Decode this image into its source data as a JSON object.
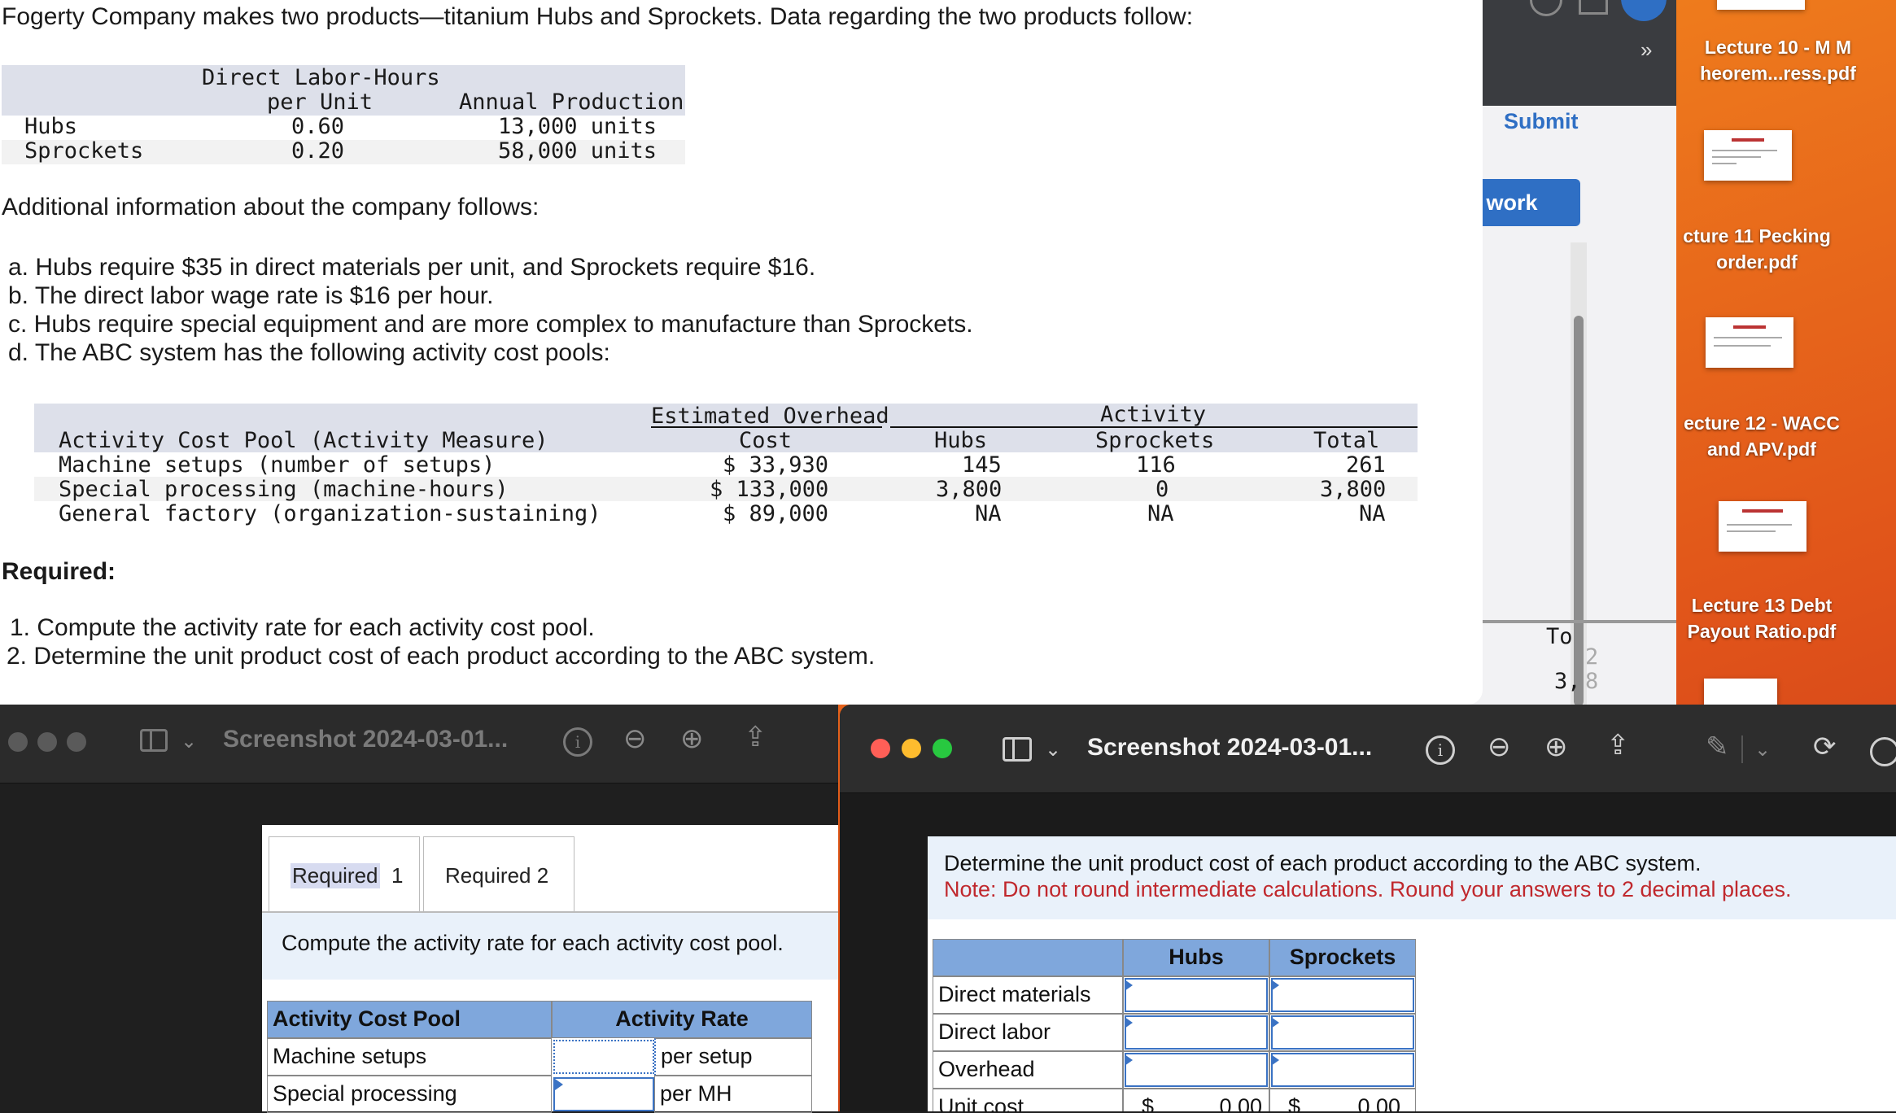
{
  "problem": {
    "intro": "Fogerty Company makes two products—titanium Hubs and Sprockets. Data regarding the two products follow:",
    "product_table": {
      "header_dlh_line1": "Direct Labor-Hours",
      "header_dlh_line2": "per Unit",
      "header_annual": "Annual Production",
      "rows": [
        {
          "name": "Hubs",
          "dlh": "0.60",
          "production": "13,000 units"
        },
        {
          "name": "Sprockets",
          "dlh": "0.20",
          "production": "58,000 units"
        }
      ]
    },
    "additional_heading": "Additional information about the company follows:",
    "items": [
      "a. Hubs require $35 in direct materials per unit, and Sprockets require $16.",
      "b. The direct labor wage rate is $16 per hour.",
      "c. Hubs require special equipment and are more complex to manufacture than Sprockets.",
      "d. The ABC system has the following activity cost pools:"
    ],
    "activity_table": {
      "header_pool": "Activity Cost Pool (Activity Measure)",
      "header_est_line1": "Estimated Overhead",
      "header_est_line2": "Cost",
      "header_activity": "Activity",
      "header_hubs": "Hubs",
      "header_sprockets": "Sprockets",
      "header_total": "Total",
      "rows": [
        {
          "pool": "Machine setups (number of setups)",
          "cost": "$ 33,930",
          "hubs": "145",
          "sprockets": "116",
          "total": "261"
        },
        {
          "pool": "Special processing (machine-hours)",
          "cost": "$ 133,000",
          "hubs": "3,800",
          "sprockets": "0",
          "total": "3,800"
        },
        {
          "pool": "General factory (organization-sustaining)",
          "cost": "$ 89,000",
          "hubs": "NA",
          "sprockets": "NA",
          "total": "NA"
        }
      ]
    },
    "required_heading": "Required:",
    "requirements": [
      "1. Compute the activity rate for each activity cost pool.",
      "2. Determine the unit product cost of each product according to the ABC system."
    ]
  },
  "browser": {
    "overflow_chevron": "»",
    "submit": "Submit",
    "my_work_partial": "y work",
    "partial_total_header": "To",
    "partial_total_a": "2",
    "partial_total_b_left": "3,",
    "partial_total_b_right": "8"
  },
  "desktop_files": [
    {
      "label": "Lecture 10 - M M\nheorem...ress.pdf"
    },
    {
      "label": "cture 11 Pecking\norder.pdf"
    },
    {
      "label": "ecture 12 - WACC\nand APV.pdf"
    },
    {
      "label": "Lecture 13 Debt\nPayout Ratio.pdf"
    }
  ],
  "window_left": {
    "title": "Screenshot 2024-03-01...",
    "tabs": [
      {
        "label_main": "Required",
        "label_suffix": "1"
      },
      {
        "label": "Required 2"
      }
    ],
    "instruction": "Compute the activity rate for each activity cost pool.",
    "table": {
      "col1": "Activity Cost Pool",
      "col2": "Activity Rate",
      "rows": [
        {
          "pool": "Machine setups",
          "unit": "per setup"
        },
        {
          "pool": "Special processing",
          "unit": "per MH"
        }
      ]
    }
  },
  "window_right": {
    "title": "Screenshot 2024-03-01...",
    "instruction": "Determine the unit product cost of each product according to the ABC system.",
    "note": "Note: Do not round intermediate calculations. Round your answers to 2 decimal places.",
    "table": {
      "col_hubs": "Hubs",
      "col_sprockets": "Sprockets",
      "rows": [
        "Direct materials",
        "Direct labor",
        "Overhead",
        "Unit cost"
      ],
      "currency": "$",
      "unit_cost_hubs": "0.00",
      "unit_cost_sprockets": "0.00"
    }
  },
  "colors": {
    "accent_blue": "#3b73c4",
    "header_blue": "#7fa7dc",
    "note_red": "#c0282d",
    "submit_blue": "#2f6fc4"
  }
}
